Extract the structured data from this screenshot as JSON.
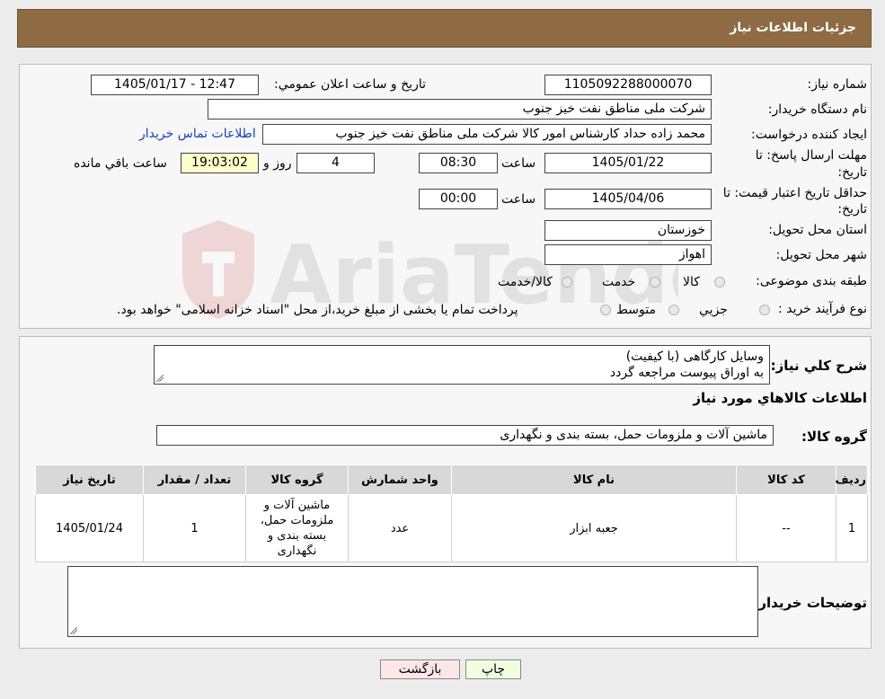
{
  "header": {
    "title": "جزئیات اطلاعات نیاز"
  },
  "form": {
    "need_number_label": "شماره نیاز:",
    "need_number": "1105092288000070",
    "announce_label": "تاریخ و ساعت اعلان عمومي:",
    "announce_value": "1405/01/17 - 12:47",
    "buyer_org_label": "نام دستگاه خریدار:",
    "buyer_org": "شرکت ملی مناطق نفت خیز جنوب",
    "creator_label": "ایجاد کننده درخواست:",
    "creator": "محمد زاده حداد کارشناس امور کالا شرکت ملی مناطق نفت خیز جنوب",
    "contact_link": "اطلاعات تماس خریدار",
    "deadline_label": "مهلت ارسال پاسخ: تا",
    "deadline_label2": "تاریخ:",
    "deadline_date": "1405/01/22",
    "time_label": "ساعت",
    "deadline_time": "08:30",
    "days_value": "4",
    "days_label": "روز و",
    "remaining_time": "19:03:02",
    "remaining_label": "ساعت باقي مانده",
    "validity_label": "حداقل تاریخ اعتبار قیمت: تا",
    "validity_label2": "تاریخ:",
    "validity_date": "1405/04/06",
    "validity_time": "00:00",
    "province_label": "استان محل تحویل:",
    "province": "خوزستان",
    "city_label": "شهر محل تحویل:",
    "city": "اهواز",
    "category_label": "طبقه بندی موضوعی:",
    "category_options": [
      "کالا",
      "خدمت",
      "کالا/خدمت"
    ],
    "process_label": "نوع فرآیند خرید :",
    "process_options": [
      "جزیي",
      "متوسط"
    ],
    "process_note": "پرداخت تمام یا بخشی از مبلغ خرید،از محل \"اسناد خزانه اسلامی\" خواهد بود."
  },
  "summary": {
    "desc_label": "شرح کلي نیاز:",
    "desc_line1": "وسایل کارگاهی (با کیفیت)",
    "desc_line2": "به اوراق پیوست مراجعه گردد",
    "goods_info_title": "اطلاعات کالاهاي مورد نیاز",
    "group_label": "گروه کالا:",
    "group_value": "ماشین آلات و ملزومات حمل، بسته بندی و نگهداری",
    "table": {
      "headers": [
        "ردیف",
        "کد کالا",
        "نام کالا",
        "واحد شمارش",
        "گروه کالا",
        "تعداد / مقدار",
        "تاریخ نیاز"
      ],
      "rows": [
        [
          "1",
          "--",
          "جعبه ابزار",
          "عدد",
          "ماشین آلات و ملزومات حمل، بسته بندی و نگهداری",
          "1",
          "1405/01/24"
        ]
      ]
    },
    "buyer_notes_label": "توضیحات خریدار:"
  },
  "buttons": {
    "print": "چاپ",
    "back": "بازگشت"
  },
  "watermark": {
    "text": "AriaTender.neT"
  },
  "colors": {
    "header": "#8f6b43",
    "highlight": "#ffffcc",
    "link": "#1a3fbf",
    "print_btn": "#f0ffe0",
    "back_btn": "#ffe6e6"
  }
}
